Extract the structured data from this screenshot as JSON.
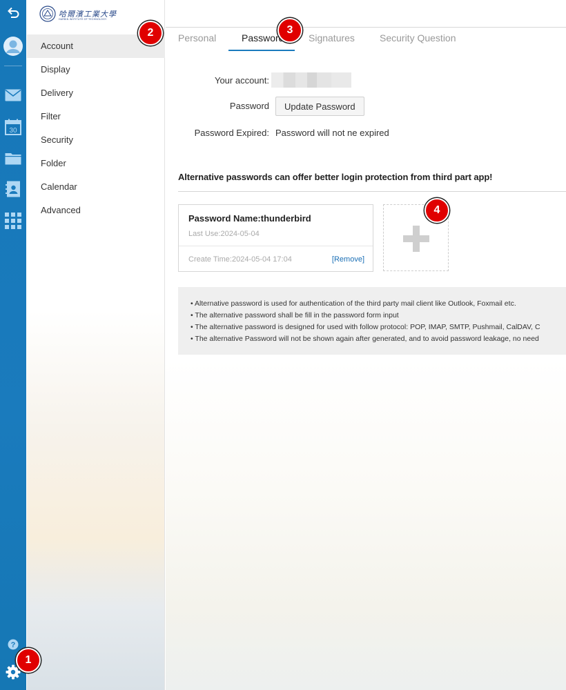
{
  "rail": {
    "icons": [
      "back-icon",
      "avatar-icon",
      "mail-icon",
      "calendar-icon",
      "folder-icon",
      "contacts-icon",
      "apps-icon",
      "help-icon",
      "settings-icon"
    ],
    "calendar_day": "30",
    "help_glyph": "?"
  },
  "logo": {
    "cn": "哈爾濱工業大學",
    "en": "HARBIN INSTITUTE OF TECHNOLOGY"
  },
  "nav": {
    "items": [
      {
        "label": "Account",
        "active": true
      },
      {
        "label": "Display"
      },
      {
        "label": "Delivery"
      },
      {
        "label": "Filter"
      },
      {
        "label": "Security"
      },
      {
        "label": "Folder"
      },
      {
        "label": "Calendar"
      },
      {
        "label": "Advanced"
      }
    ]
  },
  "tabs": {
    "personal": "Personal",
    "password": "Password",
    "signatures": "Signatures",
    "security_question": "Security Question",
    "active": "Password"
  },
  "form": {
    "account_label": "Your account:",
    "password_label": "Password",
    "update_button": "Update Password",
    "expired_label": "Password Expired:",
    "expired_value": "Password will not ne expired"
  },
  "alt": {
    "heading": "Alternative passwords can offer better login protection from third part app!",
    "card": {
      "name": "Password Name:thunderbird",
      "last_use": "Last Use:2024-05-04",
      "create_time": "Create Time:2024-05-04 17:04",
      "remove": "[Remove]"
    }
  },
  "notes": [
    "• Alternative password is used for authentication of the third party mail client like Outlook, Foxmail etc.",
    "• The alternative password shall be fill in the password form input",
    "• The alternative password is designed for used with follow protocol: POP, IMAP, SMTP, Pushmail, CalDAV, C",
    "• The alternative Password will not be shown again after generated, and to avoid password leakage, no need"
  ],
  "badges": [
    "1",
    "2",
    "3",
    "4"
  ],
  "colors": {
    "rail": "#1a7bbd",
    "accent": "#1a7bbd",
    "badge": "#e00000",
    "link": "#1a6fb5"
  }
}
